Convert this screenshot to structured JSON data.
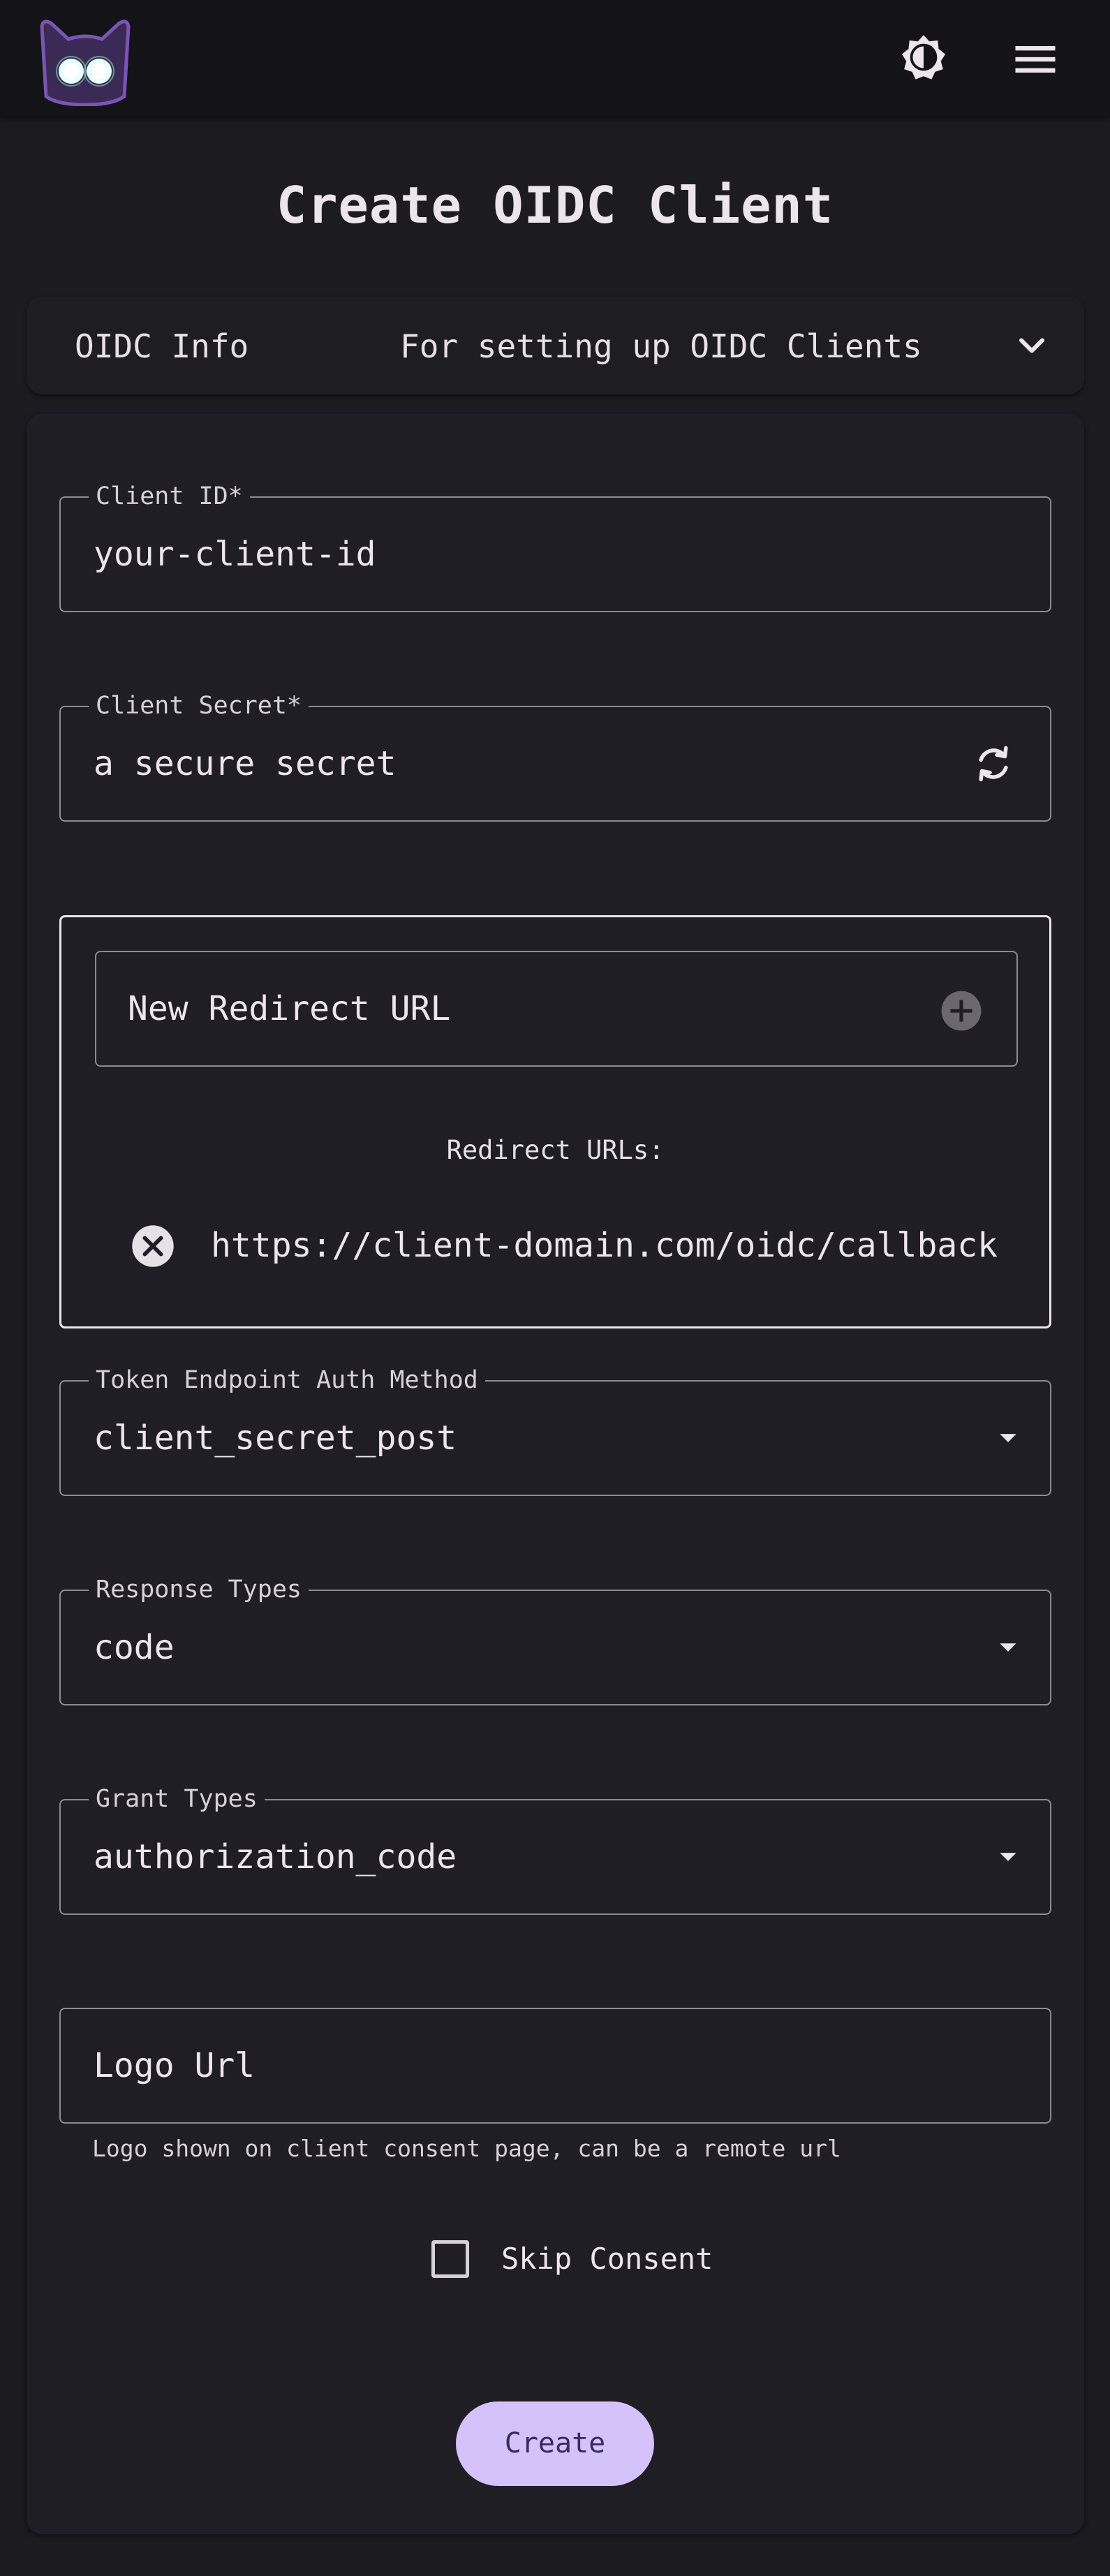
{
  "appbar": {
    "logo_icon": "cat-logo-icon",
    "theme_icon": "brightness-toggle-icon",
    "menu_icon": "hamburger-menu-icon"
  },
  "page": {
    "title": "Create OIDC Client"
  },
  "info_panel": {
    "title": "OIDC Info",
    "subtitle": "For setting up OIDC Clients",
    "expand_icon": "chevron-down-icon"
  },
  "form": {
    "client_id": {
      "label": "Client ID*",
      "value": "your-client-id"
    },
    "client_secret": {
      "label": "Client Secret*",
      "value": "a secure secret",
      "icon": "refresh-icon"
    },
    "redirect": {
      "placeholder": "New Redirect URL",
      "add_icon": "add-circle-icon",
      "heading": "Redirect URLs:",
      "urls": [
        "https://client-domain.com/oidc/callback"
      ],
      "remove_icon": "cancel-circle-icon"
    },
    "token_auth": {
      "label": "Token Endpoint Auth Method",
      "value": "client_secret_post"
    },
    "response_types": {
      "label": "Response Types",
      "value": "code"
    },
    "grant_types": {
      "label": "Grant Types",
      "value": "authorization_code"
    },
    "logo_url": {
      "placeholder": "Logo Url",
      "helper": "Logo shown on client consent page, can be a remote url"
    },
    "skip_consent": {
      "label": "Skip Consent",
      "checked": false
    },
    "create_label": "Create"
  },
  "colors": {
    "background": "#1c1b20",
    "surface": "#1f1e24",
    "appbar": "#141318",
    "primary": "#d6c2fa",
    "on_primary": "#3a2a60",
    "outline": "#8d8a92"
  }
}
